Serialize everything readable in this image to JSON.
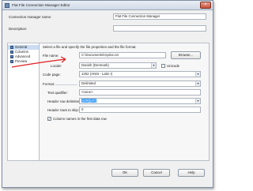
{
  "window": {
    "title": "Flat File Connection Manager Editor",
    "close_glyph": "×"
  },
  "connection": {
    "name_label": "Connection manager name:",
    "name_value": "Flat File Connection Manager",
    "description_label": "Description:",
    "description_value": ""
  },
  "nav": {
    "items": [
      {
        "label": "General",
        "selected": true
      },
      {
        "label": "Columns",
        "selected": false
      },
      {
        "label": "Advanced",
        "selected": false
      },
      {
        "label": "Preview",
        "selected": false
      }
    ]
  },
  "general": {
    "instruction": "Select a file and specify the file properties and the file format.",
    "file_name_label": "File name:",
    "file_name_value": "C:\\Documents\\mydoc.txt",
    "browse_label": "Browse...",
    "locale_label": "Locale:",
    "locale_value": "Danish (Denmark)",
    "unicode_label": "Unicode",
    "unicode_checked": false,
    "code_page_label": "Code page:",
    "code_page_value": "1252 (ANSI - Latin I)"
  },
  "format": {
    "format_label": "Format:",
    "format_value": "Delimited",
    "text_qualifier_label": "Text qualifier:",
    "text_qualifier_value": "<none>",
    "header_delimiter_label": "Header row delimiter:",
    "header_delimiter_value": "{CR}{LF}",
    "header_skip_label": "Header rows to skip:",
    "header_skip_value": "0",
    "column_names_label": "Column names in the first data row",
    "column_names_checked": true
  },
  "footer": {
    "ok_label": "OK",
    "cancel_label": "Cancel",
    "help_label": "Help"
  },
  "colors": {
    "annotation_arrow": "#e02020",
    "selection": "#3399ff"
  }
}
